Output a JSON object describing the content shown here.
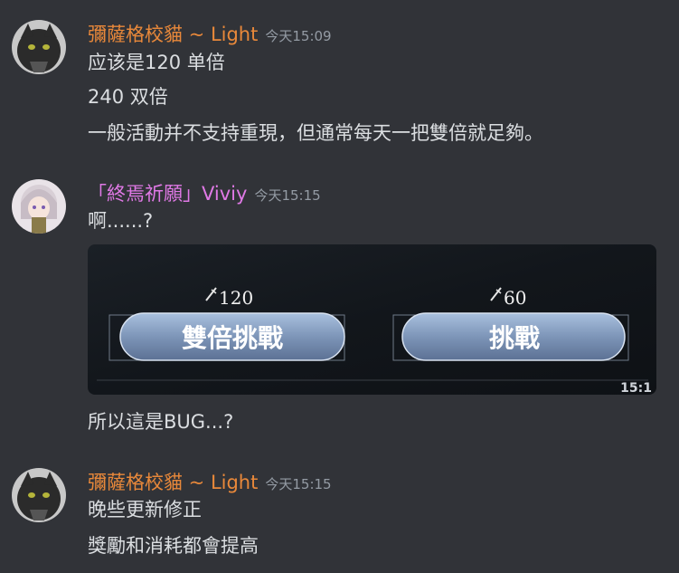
{
  "colors": {
    "background": "#313338",
    "text": "#dbdee1",
    "muted": "#949ba4",
    "user_light": "#e8883a",
    "user_viviy": "#e079e6"
  },
  "groups": [
    {
      "username": "彌薩格校貓 ~ Light",
      "timestamp": "今天15:09",
      "messages": [
        "应该是120 单倍",
        "240 双倍",
        "一般活動并不支持重現，但通常每天一把雙倍就足夠。"
      ]
    },
    {
      "username": "「終焉祈願」Viviy",
      "timestamp": "今天15:15",
      "messages": [
        "啊......?",
        "所以這是BUG...?"
      ],
      "attachment": {
        "left_cost": "120",
        "left_button": "雙倍挑戰",
        "right_cost": "60",
        "right_button": "挑戰",
        "corner_text": "15:1"
      }
    },
    {
      "username": "彌薩格校貓 ~ Light",
      "timestamp": "今天15:15",
      "messages": [
        "晚些更新修正",
        "獎勵和消耗都會提高"
      ]
    }
  ]
}
